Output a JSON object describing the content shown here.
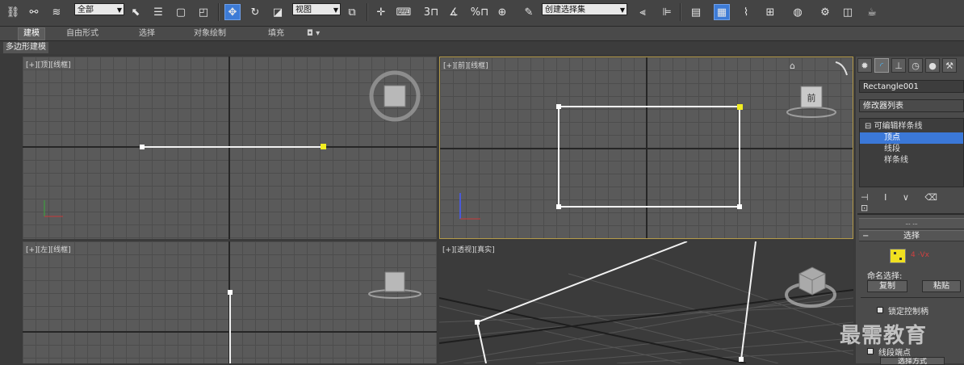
{
  "toolbar": {
    "selection_filter": "全部",
    "view_dropdown": "视图",
    "named_selection_set": "创建选择集",
    "snap_angle": "3",
    "snap_percent": "%"
  },
  "ribbon": {
    "tabs": [
      "建模",
      "自由形式",
      "选择",
      "对象绘制",
      "填充"
    ],
    "active_tab": "建模",
    "sub_tab": "多边形建模"
  },
  "viewports": {
    "top": "[+][顶][线框]",
    "front": "[+][前][线框]",
    "left": "[+][左][线框]",
    "perspective": "[+][透视][真实]"
  },
  "viewcube": {
    "front_face": "前"
  },
  "command_panel": {
    "object_name": "Rectangle001",
    "modifier_list": "修改器列表",
    "stack_items": [
      {
        "label": "可编辑样条线",
        "selected": false
      },
      {
        "label": "顶点",
        "selected": true
      },
      {
        "label": "线段",
        "selected": false
      },
      {
        "label": "样条线",
        "selected": false
      }
    ],
    "rollout_tiny": "··· ···",
    "rollout_selection": "选择",
    "vertex_count": "4 ·Vx",
    "named_selections": "命名选择:",
    "copy_button": "复制",
    "paste_button": "粘贴",
    "lock_handles": "锁定控制柄",
    "segment_end": "线段端点",
    "options_button": "选择方式"
  },
  "watermark": "最需教育",
  "colors": {
    "active_viewport_border": "#b59b49",
    "selection_blue": "#3b78d8",
    "vertex_yellow": "#f2ee21"
  }
}
